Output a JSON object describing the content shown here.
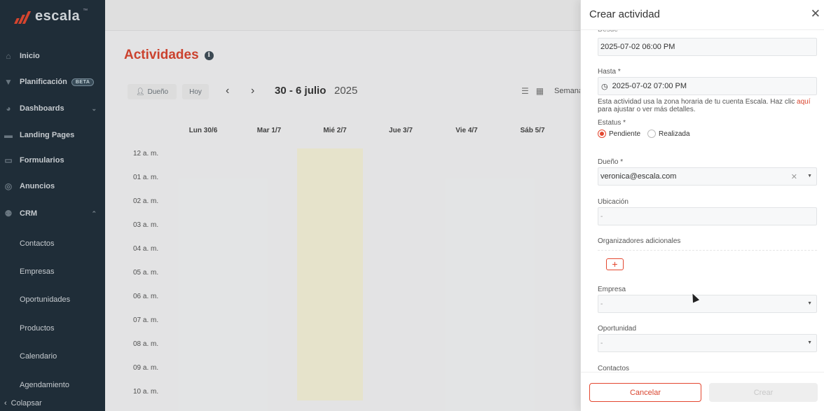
{
  "brand": {
    "name": "escala",
    "tm": "™",
    "accent": "#e4472f"
  },
  "sidebar": {
    "items": [
      {
        "label": "Inicio",
        "icon": "home-icon"
      },
      {
        "label": "Planificación",
        "icon": "funnel-icon",
        "badge": "BETA"
      },
      {
        "label": "Dashboards",
        "icon": "pie-chart-icon"
      },
      {
        "label": "Landing Pages",
        "icon": "layout-icon"
      },
      {
        "label": "Formularios",
        "icon": "form-icon"
      },
      {
        "label": "Anuncios",
        "icon": "target-icon"
      },
      {
        "label": "CRM",
        "icon": "people-icon"
      }
    ],
    "crm_sub": [
      "Contactos",
      "Empresas",
      "Oportunidades",
      "Productos",
      "Calendario",
      "Agendamiento"
    ],
    "collapse_label": "Colapsar"
  },
  "main": {
    "title": "Actividades",
    "filter_owner": "Dueño",
    "today_button": "Hoy",
    "week_range": "30 - 6 julio",
    "year": "2025",
    "view_label": "Semana",
    "days": [
      "Lun 30/6",
      "Mar 1/7",
      "Mié 2/7",
      "Jue 3/7",
      "Vie 4/7",
      "Sáb 5/7"
    ],
    "hours": [
      "12 a. m.",
      "01 a. m.",
      "02 a. m.",
      "03 a. m.",
      "04 a. m.",
      "05 a. m.",
      "06 a. m.",
      "07 a. m.",
      "08 a. m.",
      "09 a. m.",
      "10 a. m."
    ]
  },
  "drawer": {
    "title": "Crear actividad",
    "desde_label": "Desde *",
    "desde_value": "2025-07-02 06:00 PM",
    "hasta_label": "Hasta *",
    "hasta_value": "2025-07-02 07:00 PM",
    "note_text": "Esta actividad usa la zona horaria de tu cuenta Escala. Haz clic ",
    "note_link": "aquí",
    "note_text2": " para ajustar o ver más detalles.",
    "status_label": "Estatus *",
    "status_options": [
      "Pendiente",
      "Realizada"
    ],
    "owner_label": "Dueño *",
    "owner_value": "veronica@escala.com",
    "location_label": "Ubicación",
    "location_placeholder": "-",
    "organizers_label": "Organizadores adicionales",
    "company_label": "Empresa",
    "company_placeholder": "-",
    "opportunity_label": "Oportunidad",
    "opportunity_placeholder": "-",
    "contacts_label": "Contactos",
    "cancel_label": "Cancelar",
    "create_label": "Crear"
  }
}
